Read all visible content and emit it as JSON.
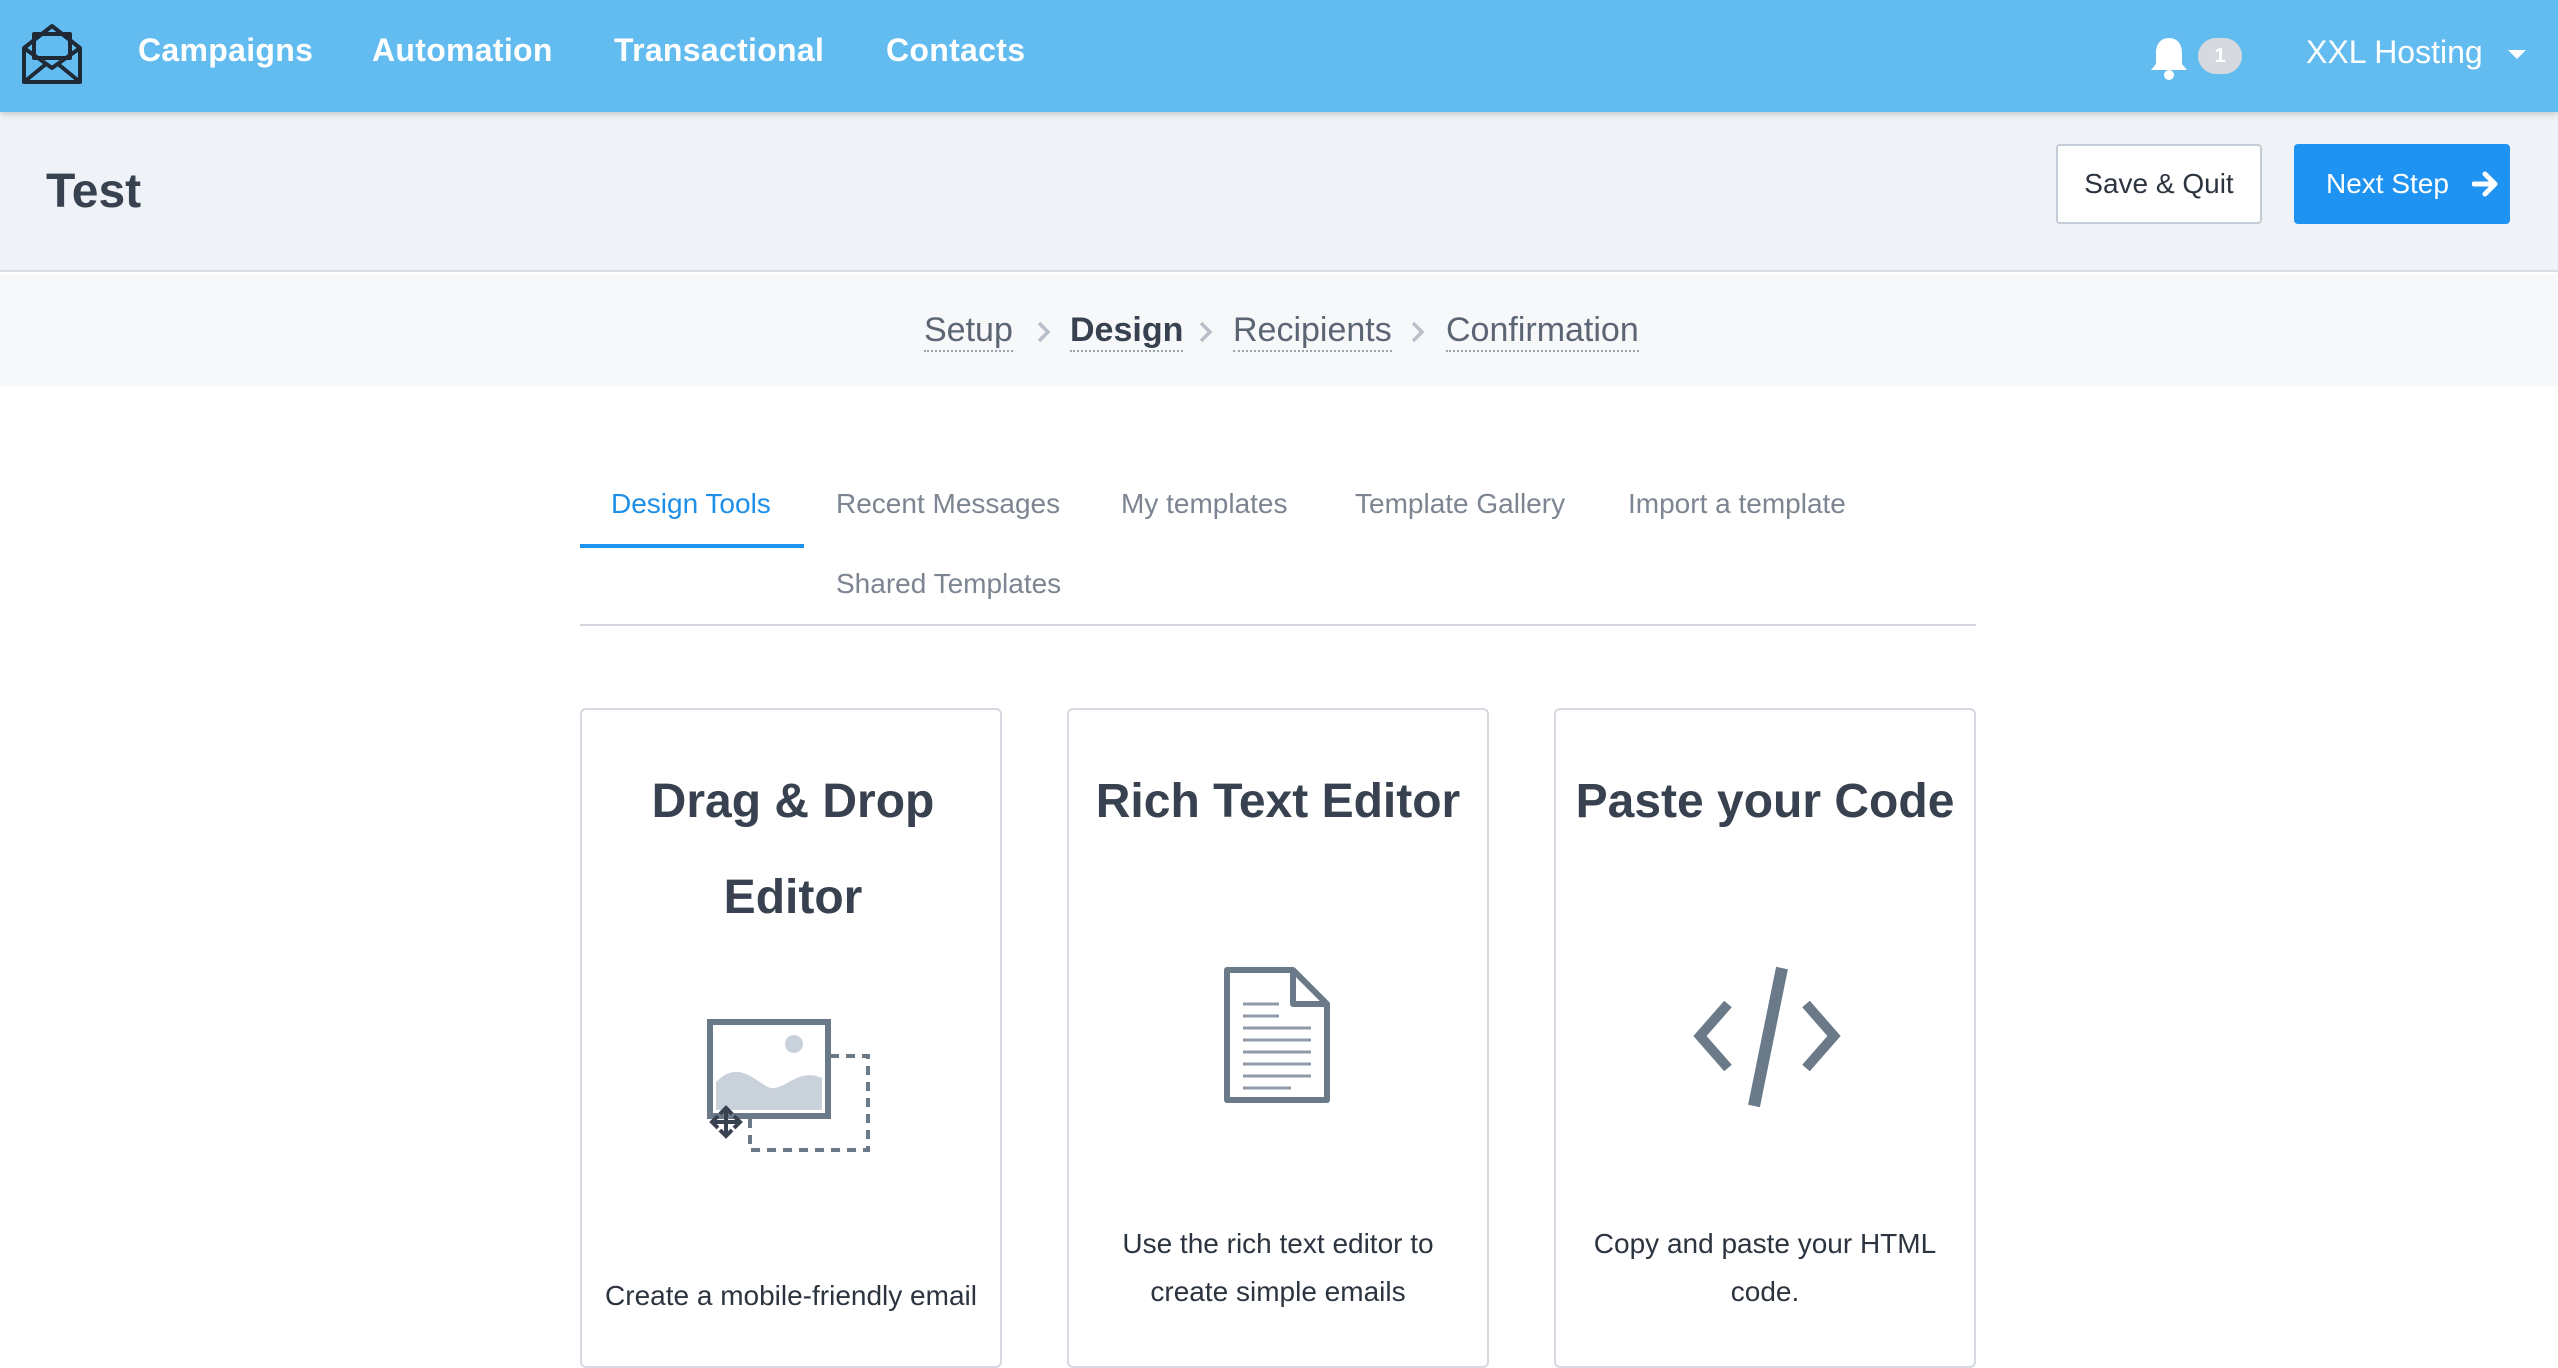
{
  "nav": {
    "items": [
      "Campaigns",
      "Automation",
      "Transactional",
      "Contacts"
    ],
    "notification_count": "1",
    "account_name": "XXL Hosting"
  },
  "header": {
    "title": "Test",
    "save_quit_label": "Save & Quit",
    "next_step_label": "Next Step"
  },
  "steps": {
    "items": [
      "Setup",
      "Design",
      "Recipients",
      "Confirmation"
    ],
    "active": "Design"
  },
  "tabs": {
    "items": [
      "Design Tools",
      "Recent Messages",
      "My templates",
      "Template Gallery",
      "Import a template",
      "Shared Templates"
    ],
    "active": "Design Tools"
  },
  "cards": [
    {
      "title": "Drag & Drop Editor",
      "icon": "drag-drop-image-icon",
      "description": "Create a mobile-friendly email"
    },
    {
      "title": "Rich Text Editor",
      "icon": "document-icon",
      "description": "Use the rich text editor to create simple emails"
    },
    {
      "title": "Paste your Code",
      "icon": "code-icon",
      "description": "Copy and paste your HTML code."
    }
  ],
  "colors": {
    "navbar": "#63bcf0",
    "primary_button": "#1e93f2",
    "active_tab": "#1e8fe8",
    "text": "#37414f"
  }
}
